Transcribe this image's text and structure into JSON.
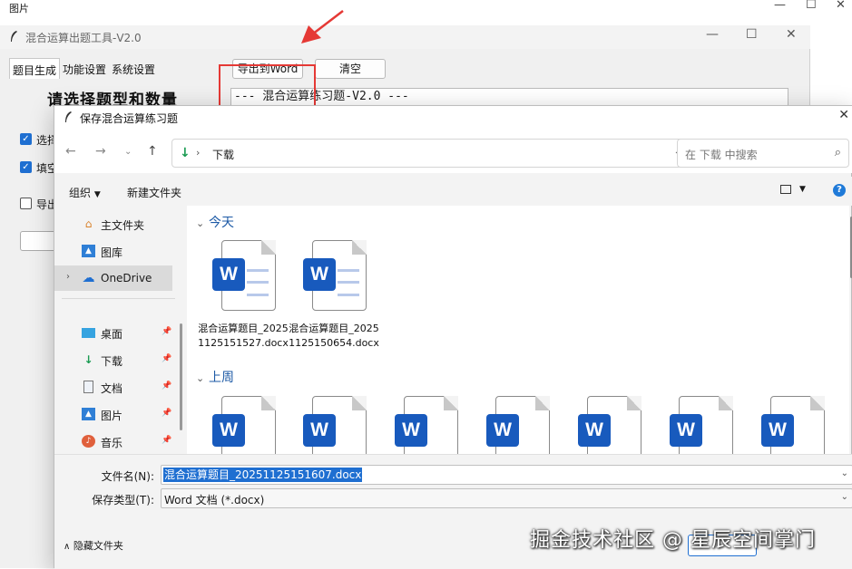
{
  "viewer": {
    "title": "图片"
  },
  "app": {
    "title": "混合运算出题工具-V2.0",
    "tabs": [
      "题目生成",
      "功能设置",
      "系统设置"
    ],
    "heading": "请选择题型和数量",
    "buttons": {
      "export": "导出到Word",
      "clear": "清空"
    },
    "output_text": "--- 混合运算练习题-V2.0 ---",
    "checkboxes": [
      {
        "label": "选择",
        "checked": true
      },
      {
        "label": "填空",
        "checked": true
      },
      {
        "label": "导出",
        "checked": false
      }
    ]
  },
  "dialog": {
    "title": "保存混合运算练习题",
    "address": {
      "path": "下载"
    },
    "search": {
      "placeholder": "在 下载 中搜索"
    },
    "commands": {
      "organize": "组织",
      "new_folder": "新建文件夹"
    },
    "sidebar": [
      {
        "label": "主文件夹",
        "icon": "home-icon",
        "pinned": false
      },
      {
        "label": "图库",
        "icon": "gallery-icon",
        "pinned": false
      },
      {
        "label": "OneDrive",
        "icon": "cloud-icon",
        "pinned": false,
        "selected": true,
        "expandable": true
      },
      {
        "label": "桌面",
        "icon": "desktop-icon",
        "pinned": true
      },
      {
        "label": "下载",
        "icon": "download-icon",
        "pinned": true
      },
      {
        "label": "文档",
        "icon": "document-icon",
        "pinned": true
      },
      {
        "label": "图片",
        "icon": "picture-icon",
        "pinned": true
      },
      {
        "label": "音乐",
        "icon": "music-icon",
        "pinned": true
      }
    ],
    "groups": [
      {
        "label": "今天",
        "files": [
          "混合运算题目_20251125151527.docx",
          "混合运算题目_20251125150654.docx"
        ]
      },
      {
        "label": "上周",
        "files": [
          "",
          "",
          "",
          "",
          "",
          "",
          ""
        ]
      }
    ],
    "filename_label": "文件名(N):",
    "filename_value": "混合运算题目_20251125151607.docx",
    "filetype_label": "保存类型(T):",
    "filetype_value": "Word 文档 (*.docx)",
    "hide_folders": "隐藏文件夹"
  },
  "watermark": "掘金技术社区 @ 星辰空间掌门",
  "colors": {
    "accent": "#1f6fd1",
    "word_blue": "#185abd",
    "highlight_red": "#e53935"
  }
}
